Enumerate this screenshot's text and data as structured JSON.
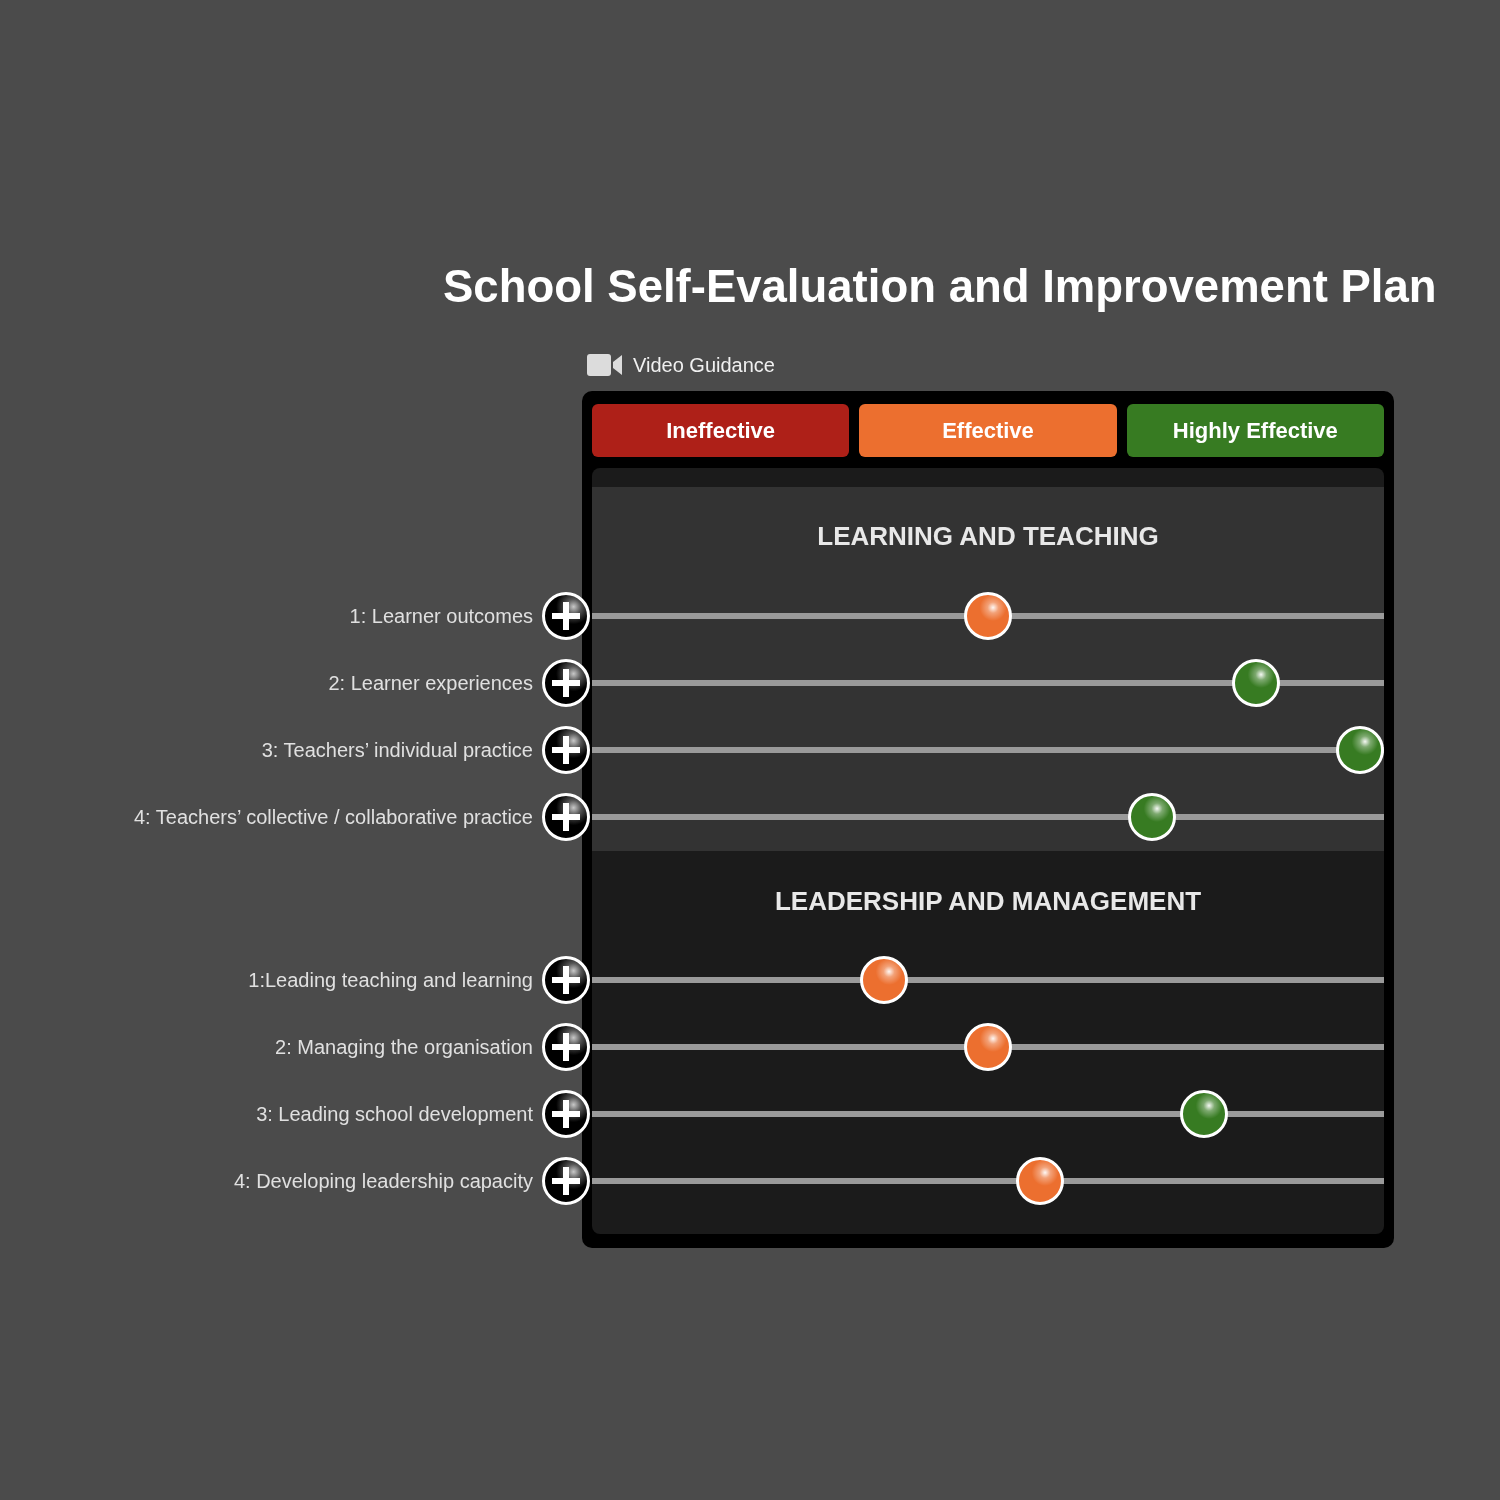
{
  "title": "School Self-Evaluation and Improvement Plan",
  "video_guidance": {
    "label": "Video Guidance"
  },
  "ratings": [
    {
      "label": "Ineffective",
      "color": "#ae2018"
    },
    {
      "label": "Effective",
      "color": "#ec6f2f"
    },
    {
      "label": "Highly Effective",
      "color": "#377b22"
    }
  ],
  "sections": [
    {
      "title": "LEARNING AND TEACHING",
      "items": [
        {
          "label": "1: Learner outcomes",
          "level": 0.5
        },
        {
          "label": "2: Learner experiences",
          "level": 0.86
        },
        {
          "label": "3: Teachers’ individual practice",
          "level": 1.0
        },
        {
          "label": "4: Teachers’ collective / collaborative practice",
          "level": 0.72
        }
      ]
    },
    {
      "title": "LEADERSHIP AND MANAGEMENT",
      "items": [
        {
          "label": "1:Leading teaching and learning",
          "level": 0.36
        },
        {
          "label": "2: Managing the organisation",
          "level": 0.5
        },
        {
          "label": "3: Leading school development",
          "level": 0.79
        },
        {
          "label": "4: Developing leadership capacity",
          "level": 0.57
        }
      ]
    }
  ]
}
